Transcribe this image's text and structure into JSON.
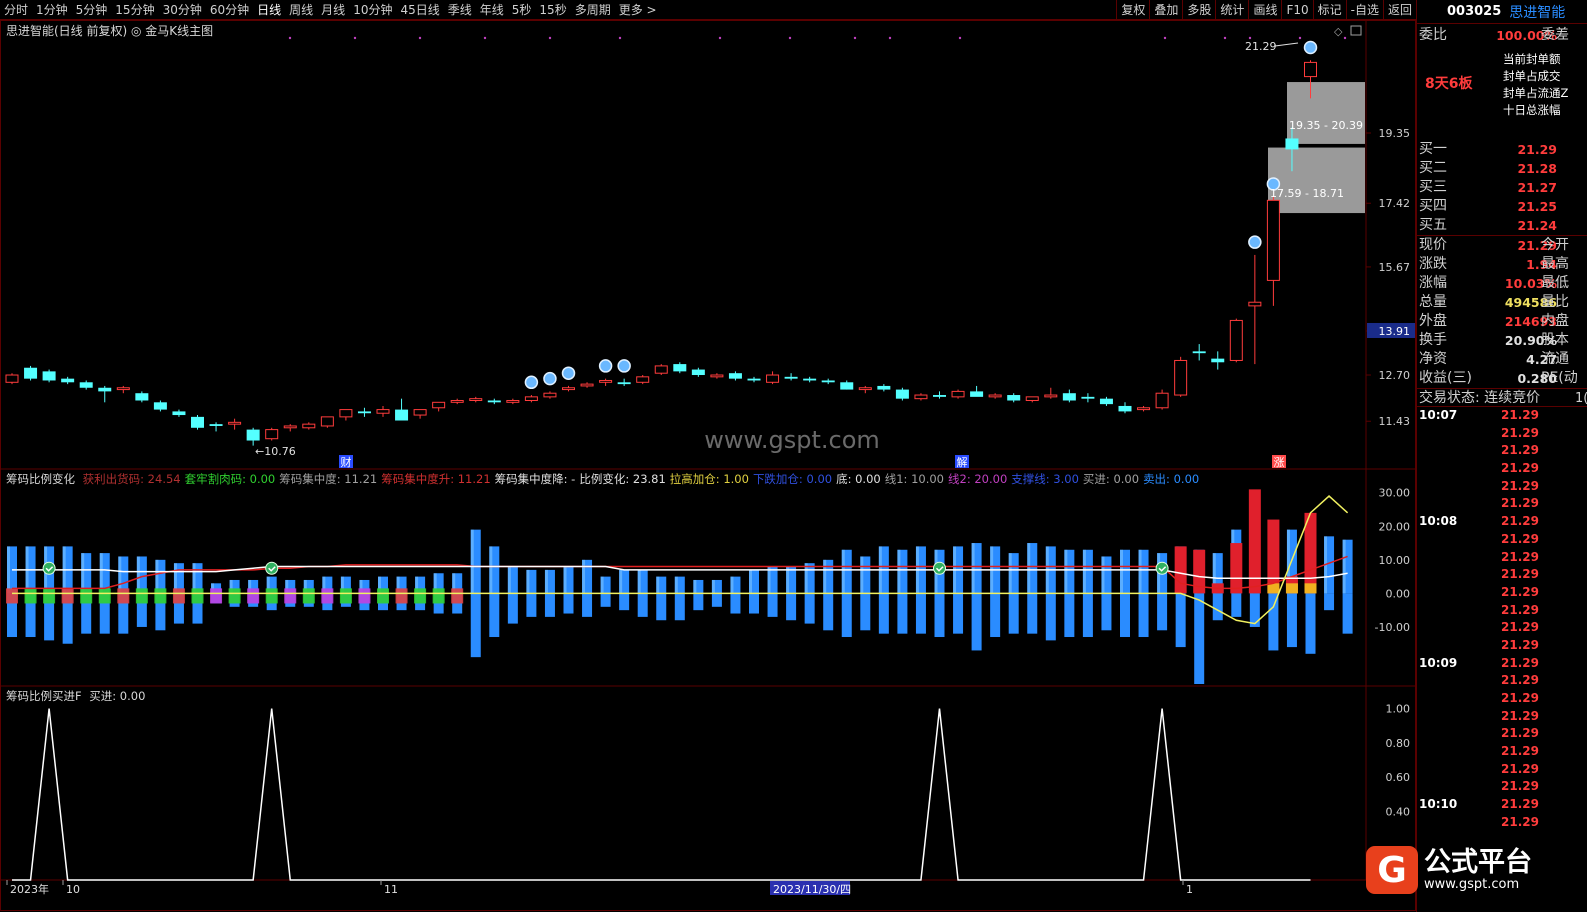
{
  "toolbar": {
    "left_tabs": [
      "分时",
      "1分钟",
      "5分钟",
      "15分钟",
      "30分钟",
      "60分钟",
      "日线",
      "周线",
      "月线",
      "10分钟",
      "45日线",
      "季线",
      "年线",
      "5秒",
      "15秒",
      "多周期",
      "更多 >"
    ],
    "right_tabs": [
      "复权",
      "叠加",
      "多股",
      "统计",
      "画线",
      "F10",
      "标记",
      "-自选",
      "返回"
    ]
  },
  "main_title": "思进智能(日线 前复权) ◎ 金马K线主图",
  "price_axis": [
    "19.35",
    "17.42",
    "15.67",
    "13.91",
    "12.70",
    "11.43"
  ],
  "chart_labels": {
    "high_label": "21.29",
    "low_label": "←10.76",
    "zone1": "19.35 - 20.39",
    "zone2": "17.59 - 18.71",
    "watermark": "www.gspt.com",
    "marker_cai": "财",
    "marker_jie": "解",
    "marker_zhang": "涨"
  },
  "indicator1": {
    "name": "筹码比例变化",
    "items": [
      {
        "text": "获利出货码: 24.54",
        "color": "#b03030"
      },
      {
        "text": "套牢割肉码: 0.00",
        "color": "#30d030"
      },
      {
        "text": "筹码集中度: 11.21",
        "color": "#a0a0a0"
      },
      {
        "text": "筹码集中度升: 11.21",
        "color": "#d03030"
      },
      {
        "text": "筹码集中度降: -",
        "color": "#e0e0e0"
      },
      {
        "text": "比例变化: 23.81",
        "color": "#e0e0e0"
      },
      {
        "text": "拉高加仓: 1.00",
        "color": "#e0d040"
      },
      {
        "text": "下跌加仓: 0.00",
        "color": "#3050e0"
      },
      {
        "text": "底: 0.00",
        "color": "#e0e0e0"
      },
      {
        "text": "线1: 10.00",
        "color": "#a0a0a0"
      },
      {
        "text": "线2: 20.00",
        "color": "#c040c0"
      },
      {
        "text": "支撑线: 3.00",
        "color": "#3050e0"
      },
      {
        "text": "买进: 0.00",
        "color": "#a0a0a0"
      },
      {
        "text": "卖出: 0.00",
        "color": "#2a8cff"
      }
    ],
    "axis": [
      "30.00",
      "20.00",
      "10.00",
      "0.00",
      "-10.00"
    ]
  },
  "indicator2": {
    "name": "筹码比例买进F",
    "buy": "买进: 0.00",
    "axis": [
      "1.00",
      "0.80",
      "0.60",
      "0.40"
    ]
  },
  "date_axis": {
    "year": "2023年",
    "m10": "10",
    "m11": "11",
    "cursor": "2023/11/30/四",
    "m1": "1"
  },
  "right_panel": {
    "code": "003025",
    "name": "思进智能",
    "weibi_label": "委比",
    "weibi_value": "100.00%",
    "weicha_label": "委差",
    "seal_tag": "8天6板",
    "seal_lines": [
      "当前封单额",
      "封单占成交",
      "封单占流通Z",
      "十日总涨幅"
    ],
    "bids": [
      {
        "k": "买一",
        "v": "21.29"
      },
      {
        "k": "买二",
        "v": "21.28"
      },
      {
        "k": "买三",
        "v": "21.27"
      },
      {
        "k": "买四",
        "v": "21.25"
      },
      {
        "k": "买五",
        "v": "21.24"
      }
    ],
    "stats": [
      {
        "k": "现价",
        "v": "21.29",
        "k2": "今开",
        "vc": "#ff3c3c"
      },
      {
        "k": "涨跌",
        "v": "1.94",
        "k2": "最高",
        "vc": "#ff3c3c"
      },
      {
        "k": "涨幅",
        "v": "10.03%",
        "k2": "最低",
        "vc": "#ff3c3c"
      },
      {
        "k": "总量",
        "v": "494586",
        "k2": "量比",
        "vc": "#f0e060"
      },
      {
        "k": "外盘",
        "v": "214693",
        "k2": "内盘",
        "vc": "#ff3c3c"
      },
      {
        "k": "换手",
        "v": "20.90%",
        "k2": "股本",
        "vc": "#e0e0e0"
      },
      {
        "k": "净资",
        "v": "4.27",
        "k2": "流通",
        "vc": "#e0e0e0"
      },
      {
        "k": "收益(三)",
        "v": "0.280",
        "k2": "PE(动",
        "vc": "#e0e0e0"
      }
    ],
    "trade_state": "交易状态: 连续竞价",
    "trade_state_tail": "1(",
    "ticks": [
      {
        "t": "10:07",
        "p": "21.29"
      },
      {
        "t": "",
        "p": "21.29"
      },
      {
        "t": "",
        "p": "21.29"
      },
      {
        "t": "",
        "p": "21.29"
      },
      {
        "t": "",
        "p": "21.29"
      },
      {
        "t": "",
        "p": "21.29"
      },
      {
        "t": "10:08",
        "p": "21.29"
      },
      {
        "t": "",
        "p": "21.29"
      },
      {
        "t": "",
        "p": "21.29"
      },
      {
        "t": "",
        "p": "21.29"
      },
      {
        "t": "",
        "p": "21.29"
      },
      {
        "t": "",
        "p": "21.29"
      },
      {
        "t": "",
        "p": "21.29"
      },
      {
        "t": "",
        "p": "21.29"
      },
      {
        "t": "10:09",
        "p": "21.29"
      },
      {
        "t": "",
        "p": "21.29"
      },
      {
        "t": "",
        "p": "21.29"
      },
      {
        "t": "",
        "p": "21.29"
      },
      {
        "t": "",
        "p": "21.29"
      },
      {
        "t": "",
        "p": "21.29"
      },
      {
        "t": "",
        "p": "21.29"
      },
      {
        "t": "",
        "p": "21.29"
      },
      {
        "t": "10:10",
        "p": "21.29"
      },
      {
        "t": "",
        "p": "21.29"
      }
    ]
  },
  "logo": {
    "brand": "公式平台",
    "url": "www.gspt.com",
    "letter": "G"
  },
  "colors": {
    "up": "#ff3c3c",
    "down": "#54ffff",
    "frame": "#5a0000",
    "blue": "#2a8cff"
  },
  "chart_data": [
    {
      "type": "candlestick",
      "title": "思进智能(日线 前复权)",
      "y_ticks": [
        19.35,
        17.42,
        15.67,
        13.91,
        12.7,
        11.43
      ],
      "ylim": [
        10.2,
        22.4
      ],
      "ohlc": [
        [
          12.5,
          12.75,
          12.45,
          12.7
        ],
        [
          12.9,
          12.95,
          12.55,
          12.6
        ],
        [
          12.8,
          12.85,
          12.5,
          12.55
        ],
        [
          12.6,
          12.65,
          12.45,
          12.5
        ],
        [
          12.5,
          12.55,
          12.3,
          12.35
        ],
        [
          12.35,
          12.4,
          11.95,
          12.25
        ],
        [
          12.3,
          12.4,
          12.2,
          12.35
        ],
        [
          12.2,
          12.25,
          11.95,
          12.0
        ],
        [
          11.95,
          12.0,
          11.7,
          11.75
        ],
        [
          11.7,
          11.75,
          11.55,
          11.6
        ],
        [
          11.55,
          11.6,
          11.2,
          11.25
        ],
        [
          11.35,
          11.4,
          11.15,
          11.3
        ],
        [
          11.35,
          11.5,
          11.2,
          11.4
        ],
        [
          11.2,
          11.25,
          10.76,
          10.9
        ],
        [
          10.95,
          11.25,
          10.9,
          11.2
        ],
        [
          11.25,
          11.35,
          11.15,
          11.3
        ],
        [
          11.25,
          11.4,
          11.2,
          11.35
        ],
        [
          11.3,
          11.5,
          11.25,
          11.55
        ],
        [
          11.55,
          11.7,
          11.45,
          11.75
        ],
        [
          11.7,
          11.8,
          11.55,
          11.65
        ],
        [
          11.65,
          11.85,
          11.55,
          11.75
        ],
        [
          11.75,
          12.05,
          11.55,
          11.45
        ],
        [
          11.6,
          11.75,
          11.5,
          11.75
        ],
        [
          11.8,
          11.95,
          11.7,
          11.95
        ],
        [
          11.95,
          12.05,
          11.9,
          12.0
        ],
        [
          12.0,
          12.1,
          11.95,
          12.05
        ],
        [
          12.0,
          12.05,
          11.9,
          11.95
        ],
        [
          11.95,
          12.05,
          11.9,
          12.0
        ],
        [
          12.0,
          12.15,
          11.95,
          12.1
        ],
        [
          12.1,
          12.25,
          12.05,
          12.2
        ],
        [
          12.3,
          12.4,
          12.25,
          12.35
        ],
        [
          12.4,
          12.5,
          12.35,
          12.45
        ],
        [
          12.5,
          12.6,
          12.4,
          12.55
        ],
        [
          12.5,
          12.6,
          12.4,
          12.45
        ],
        [
          12.5,
          12.7,
          12.45,
          12.65
        ],
        [
          12.75,
          13.0,
          12.7,
          12.95
        ],
        [
          13.0,
          13.05,
          12.75,
          12.8
        ],
        [
          12.85,
          12.9,
          12.65,
          12.7
        ],
        [
          12.65,
          12.75,
          12.6,
          12.7
        ],
        [
          12.75,
          12.8,
          12.55,
          12.6
        ],
        [
          12.6,
          12.65,
          12.5,
          12.55
        ],
        [
          12.5,
          12.8,
          12.45,
          12.7
        ],
        [
          12.65,
          12.75,
          12.55,
          12.6
        ],
        [
          12.6,
          12.65,
          12.5,
          12.55
        ],
        [
          12.55,
          12.6,
          12.45,
          12.5
        ],
        [
          12.5,
          12.55,
          12.3,
          12.3
        ],
        [
          12.3,
          12.4,
          12.2,
          12.35
        ],
        [
          12.4,
          12.45,
          12.25,
          12.3
        ],
        [
          12.3,
          12.35,
          12.0,
          12.05
        ],
        [
          12.05,
          12.2,
          12.0,
          12.15
        ],
        [
          12.15,
          12.25,
          12.05,
          12.1
        ],
        [
          12.1,
          12.3,
          12.05,
          12.25
        ],
        [
          12.25,
          12.4,
          12.15,
          12.1
        ],
        [
          12.1,
          12.2,
          12.05,
          12.15
        ],
        [
          12.15,
          12.2,
          11.95,
          12.0
        ],
        [
          12.0,
          12.1,
          11.95,
          12.1
        ],
        [
          12.1,
          12.35,
          12.05,
          12.15
        ],
        [
          12.2,
          12.3,
          11.95,
          12.0
        ],
        [
          12.1,
          12.2,
          11.95,
          12.05
        ],
        [
          12.05,
          12.1,
          11.85,
          11.9
        ],
        [
          11.85,
          11.95,
          11.65,
          11.7
        ],
        [
          11.75,
          11.85,
          11.7,
          11.8
        ],
        [
          11.8,
          12.3,
          11.75,
          12.2
        ],
        [
          12.15,
          13.2,
          12.1,
          13.1
        ],
        [
          13.35,
          13.55,
          13.1,
          13.3
        ],
        [
          13.15,
          13.35,
          12.85,
          13.05
        ],
        [
          13.1,
          14.25,
          13.05,
          14.2
        ],
        [
          14.6,
          16.0,
          13.0,
          14.7
        ],
        [
          15.3,
          17.6,
          14.6,
          17.5
        ],
        [
          19.2,
          19.5,
          18.3,
          18.9
        ],
        [
          20.9,
          21.35,
          20.3,
          21.29
        ]
      ]
    },
    {
      "type": "bar",
      "title": "筹码比例变化",
      "y_ticks": [
        30,
        20,
        10,
        0,
        -10
      ],
      "ylim": [
        -27,
        32
      ],
      "positive": [
        14,
        14,
        14,
        14,
        12,
        12,
        11,
        11,
        10,
        9,
        9,
        3,
        4,
        4,
        5,
        4,
        4,
        5,
        5,
        4,
        5,
        5,
        5,
        6,
        6,
        19,
        14,
        8,
        7,
        7,
        8,
        10,
        5,
        7,
        7,
        5,
        5,
        4,
        4,
        5,
        7,
        8,
        8,
        9,
        10,
        13,
        11,
        14,
        13,
        14,
        13,
        14,
        15,
        14,
        12,
        15,
        14,
        13,
        13,
        11,
        13,
        13,
        12,
        14,
        13,
        12,
        19,
        16,
        18,
        19,
        19,
        17,
        16
      ],
      "negative": [
        -13,
        -13,
        -14,
        -15,
        -12,
        -12,
        -12,
        -10,
        -11,
        -9,
        -9,
        -3,
        -4,
        -4,
        -5,
        -4,
        -4,
        -5,
        -4,
        -5,
        -5,
        -5,
        -5,
        -6,
        -6,
        -19,
        -13,
        -9,
        -7,
        -7,
        -6,
        -7,
        -4,
        -5,
        -7,
        -8,
        -8,
        -5,
        -4,
        -6,
        -6,
        -7,
        -8,
        -9,
        -11,
        -13,
        -11,
        -12,
        -12,
        -12,
        -13,
        -12,
        -17,
        -13,
        -12,
        -12,
        -14,
        -13,
        -13,
        -11,
        -13,
        -13,
        -11,
        -16,
        -27,
        -8,
        -7,
        -10,
        -17,
        -16,
        -18,
        -5,
        -12
      ],
      "red_bars": [
        {
          "i": 63,
          "v": 14
        },
        {
          "i": 64,
          "v": 13
        },
        {
          "i": 65,
          "v": 3
        },
        {
          "i": 66,
          "v": 15
        },
        {
          "i": 67,
          "v": 31
        },
        {
          "i": 68,
          "v": 22
        },
        {
          "i": 69,
          "v": 5
        },
        {
          "i": 70,
          "v": 24
        }
      ],
      "yellow_line": [
        0,
        0,
        0,
        0,
        0,
        0,
        0,
        0,
        0,
        0,
        0,
        0,
        0,
        0,
        0,
        0,
        0,
        0,
        0,
        0,
        0,
        0,
        0,
        0,
        0,
        0,
        0,
        0,
        0,
        0,
        0,
        0,
        0,
        0,
        0,
        0,
        0,
        0,
        0,
        0,
        0,
        0,
        0,
        0,
        0,
        0,
        0,
        0,
        0,
        0,
        0,
        0,
        0,
        0,
        0,
        0,
        0,
        0,
        0,
        0,
        0,
        0,
        0,
        0,
        -2,
        -5,
        -8,
        -9,
        -4,
        10,
        24,
        29,
        24
      ],
      "white_line": [
        7,
        7,
        7,
        7,
        7,
        7,
        6.5,
        6.5,
        6.5,
        6.5,
        6.5,
        6.5,
        7,
        7.5,
        8,
        8,
        8,
        8,
        8,
        8,
        8,
        8,
        8,
        8,
        8,
        8,
        8,
        8,
        8,
        8,
        8,
        8,
        8,
        7,
        7,
        7,
        7,
        7,
        7,
        7,
        7,
        7,
        7,
        7,
        7,
        7,
        7,
        7,
        7,
        7,
        7,
        7,
        7,
        7,
        7,
        7,
        7,
        7,
        7,
        7,
        7,
        7,
        7,
        6,
        5,
        4.5,
        4.5,
        4.5,
        4.5,
        4.5,
        4.5,
        5,
        6
      ],
      "red_line": [
        1.5,
        1.5,
        1.5,
        1.5,
        1.5,
        1.5,
        3,
        5,
        6,
        7,
        7,
        7,
        7,
        7,
        7.5,
        7.5,
        8,
        8,
        8.5,
        8.5,
        8.5,
        8.5,
        8.5,
        8.5,
        8.5,
        8,
        8,
        8,
        8,
        8,
        8,
        8,
        8,
        8,
        8,
        8,
        8,
        8,
        8,
        8,
        8,
        8,
        8,
        8,
        8,
        8,
        8,
        8,
        8,
        8,
        8,
        8,
        8,
        8,
        8,
        8,
        8,
        8,
        8,
        8,
        8,
        8,
        8,
        3,
        2,
        1.5,
        1.5,
        2,
        3,
        5,
        7,
        9,
        11
      ]
    },
    {
      "type": "line",
      "title": "筹码比例买进F",
      "y_ticks": [
        1.0,
        0.8,
        0.6,
        0.4
      ],
      "ylim": [
        0,
        1.05
      ],
      "peaks": [
        2,
        14,
        50,
        62
      ]
    }
  ]
}
